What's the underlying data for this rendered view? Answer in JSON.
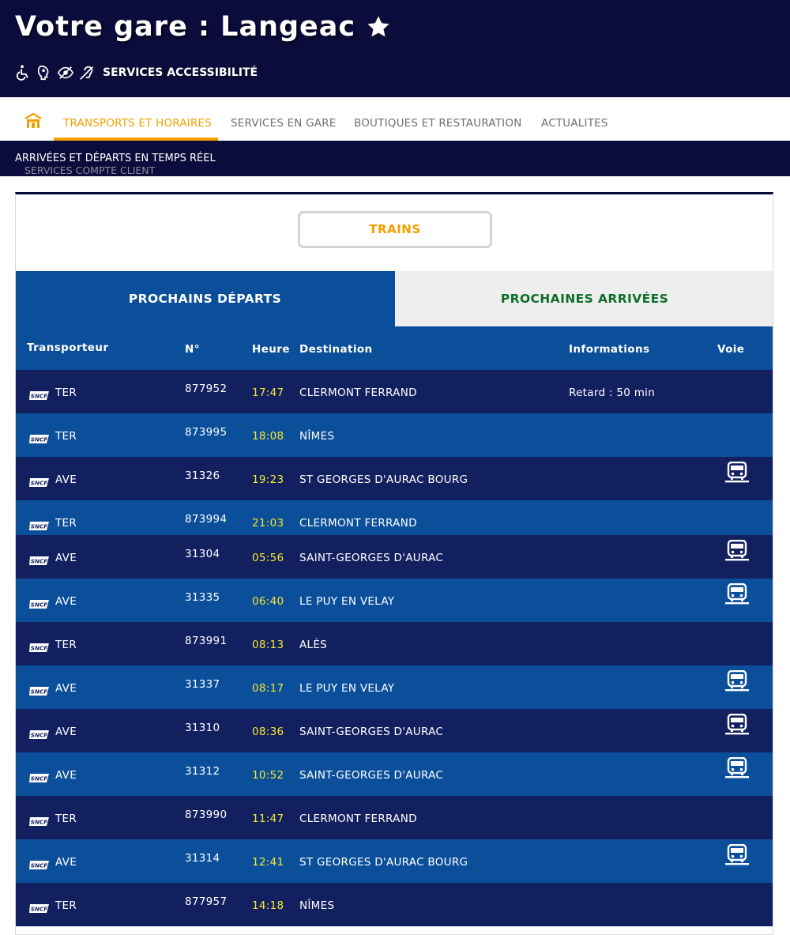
{
  "header": {
    "title": "Votre gare : Langeac",
    "accessibility_label": "SERVICES ACCESSIBILITÉ",
    "accessibility_icons": [
      "wheelchair-icon",
      "mental-disability-icon",
      "visual-impairment-icon",
      "hearing-impairment-icon"
    ]
  },
  "nav": {
    "home_icon": "station-home-icon",
    "items": [
      {
        "label": "TRANSPORTS ET HORAIRES",
        "active": true
      },
      {
        "label": "SERVICES EN GARE",
        "active": false
      },
      {
        "label": "BOUTIQUES ET RESTAURATION",
        "active": false
      },
      {
        "label": "ACTUALITES",
        "active": false
      }
    ]
  },
  "subnav": {
    "main": "ARRIVÉES ET DÉPARTS EN TEMPS RÉEL",
    "secondary": "SERVICES COMPTE CLIENT"
  },
  "board": {
    "mode_button": "TRAINS",
    "tabs": {
      "departures": "PROCHAINS DÉPARTS",
      "arrivals": "PROCHAINES ARRIVÉES"
    },
    "columns": {
      "carrier": "Transporteur",
      "number": "N°",
      "time": "Heure",
      "destination": "Destination",
      "info": "Informations",
      "platform": "Voie"
    },
    "rows": [
      {
        "carrier": "TER",
        "number": "877952",
        "time": "17:47",
        "destination": "CLERMONT FERRAND",
        "info": "Retard : 50 min",
        "bus": false
      },
      {
        "carrier": "TER",
        "number": "873995",
        "time": "18:08",
        "destination": "NÎMES",
        "info": "",
        "bus": false
      },
      {
        "carrier": "AVE",
        "number": "31326",
        "time": "19:23",
        "destination": "ST GEORGES D'AURAC BOURG",
        "info": "",
        "bus": true
      },
      {
        "carrier": "TER",
        "number": "873994",
        "time": "21:03",
        "destination": "CLERMONT FERRAND",
        "info": "",
        "bus": false
      },
      {
        "carrier": "AVE",
        "number": "31304",
        "time": "05:56",
        "destination": "SAINT-GEORGES D'AURAC",
        "info": "",
        "bus": true
      },
      {
        "carrier": "AVE",
        "number": "31335",
        "time": "06:40",
        "destination": "LE PUY EN VELAY",
        "info": "",
        "bus": true
      },
      {
        "carrier": "TER",
        "number": "873991",
        "time": "08:13",
        "destination": "ALÈS",
        "info": "",
        "bus": false
      },
      {
        "carrier": "AVE",
        "number": "31337",
        "time": "08:17",
        "destination": "LE PUY EN VELAY",
        "info": "",
        "bus": true
      },
      {
        "carrier": "AVE",
        "number": "31310",
        "time": "08:36",
        "destination": "SAINT-GEORGES D'AURAC",
        "info": "",
        "bus": true
      },
      {
        "carrier": "AVE",
        "number": "31312",
        "time": "10:52",
        "destination": "SAINT-GEORGES D'AURAC",
        "info": "",
        "bus": true
      },
      {
        "carrier": "TER",
        "number": "873990",
        "time": "11:47",
        "destination": "CLERMONT FERRAND",
        "info": "",
        "bus": false
      },
      {
        "carrier": "AVE",
        "number": "31314",
        "time": "12:41",
        "destination": "ST GEORGES D'AURAC BOURG",
        "info": "",
        "bus": true
      },
      {
        "carrier": "TER",
        "number": "877957",
        "time": "14:18",
        "destination": "NÎMES",
        "info": "",
        "bus": false
      }
    ]
  },
  "colors": {
    "header_bg": "#0c0c3c",
    "accent": "#f2a000",
    "row_dark": "#132060",
    "row_light": "#0b4f9b",
    "time_yellow": "#f4e62e",
    "arrivals_green": "#0f6e2a"
  }
}
